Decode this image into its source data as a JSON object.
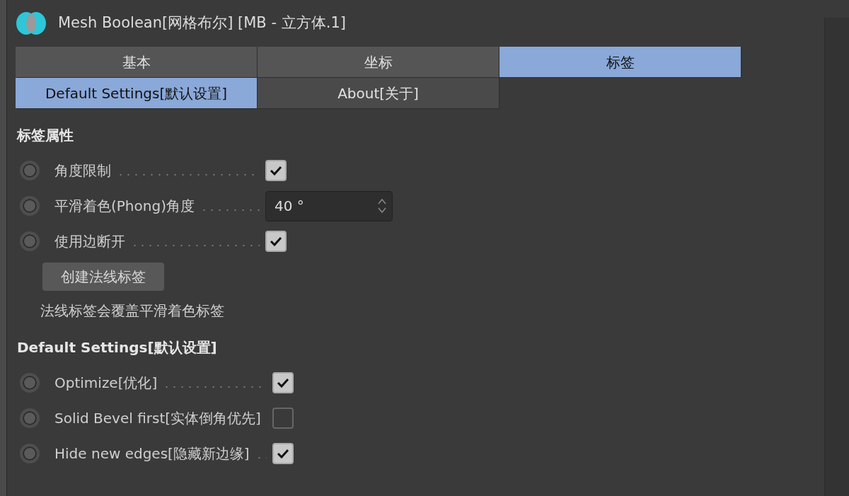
{
  "header": {
    "title": "Mesh Boolean[网格布尔] [MB - 立方体.1]"
  },
  "tab_rows": [
    [
      {
        "label": "基本",
        "selected": false
      },
      {
        "label": "坐标",
        "selected": false
      },
      {
        "label": "标签",
        "selected": true
      }
    ],
    [
      {
        "label": "Default Settings[默认设置]",
        "selected": true
      },
      {
        "label": "About[关于]",
        "selected": false
      }
    ]
  ],
  "sections": [
    {
      "title": "标签属性",
      "items": [
        {
          "kind": "checkbox",
          "label": "角度限制",
          "checked": true
        },
        {
          "kind": "number",
          "label": "平滑着色(Phong)角度",
          "value": "40 °"
        },
        {
          "kind": "checkbox",
          "label": "使用边断开",
          "checked": true
        },
        {
          "kind": "button",
          "label": "创建法线标签"
        },
        {
          "kind": "note",
          "label": "法线标签会覆盖平滑着色标签"
        }
      ]
    },
    {
      "title": "Default Settings[默认设置]",
      "items": [
        {
          "kind": "checkbox",
          "label": "Optimize[优化]",
          "checked": true
        },
        {
          "kind": "checkbox",
          "label": "Solid Bevel first[实体倒角优先]",
          "checked": false
        },
        {
          "kind": "checkbox",
          "label": "Hide new edges[隐藏新边缘]",
          "checked": true
        }
      ]
    }
  ]
}
